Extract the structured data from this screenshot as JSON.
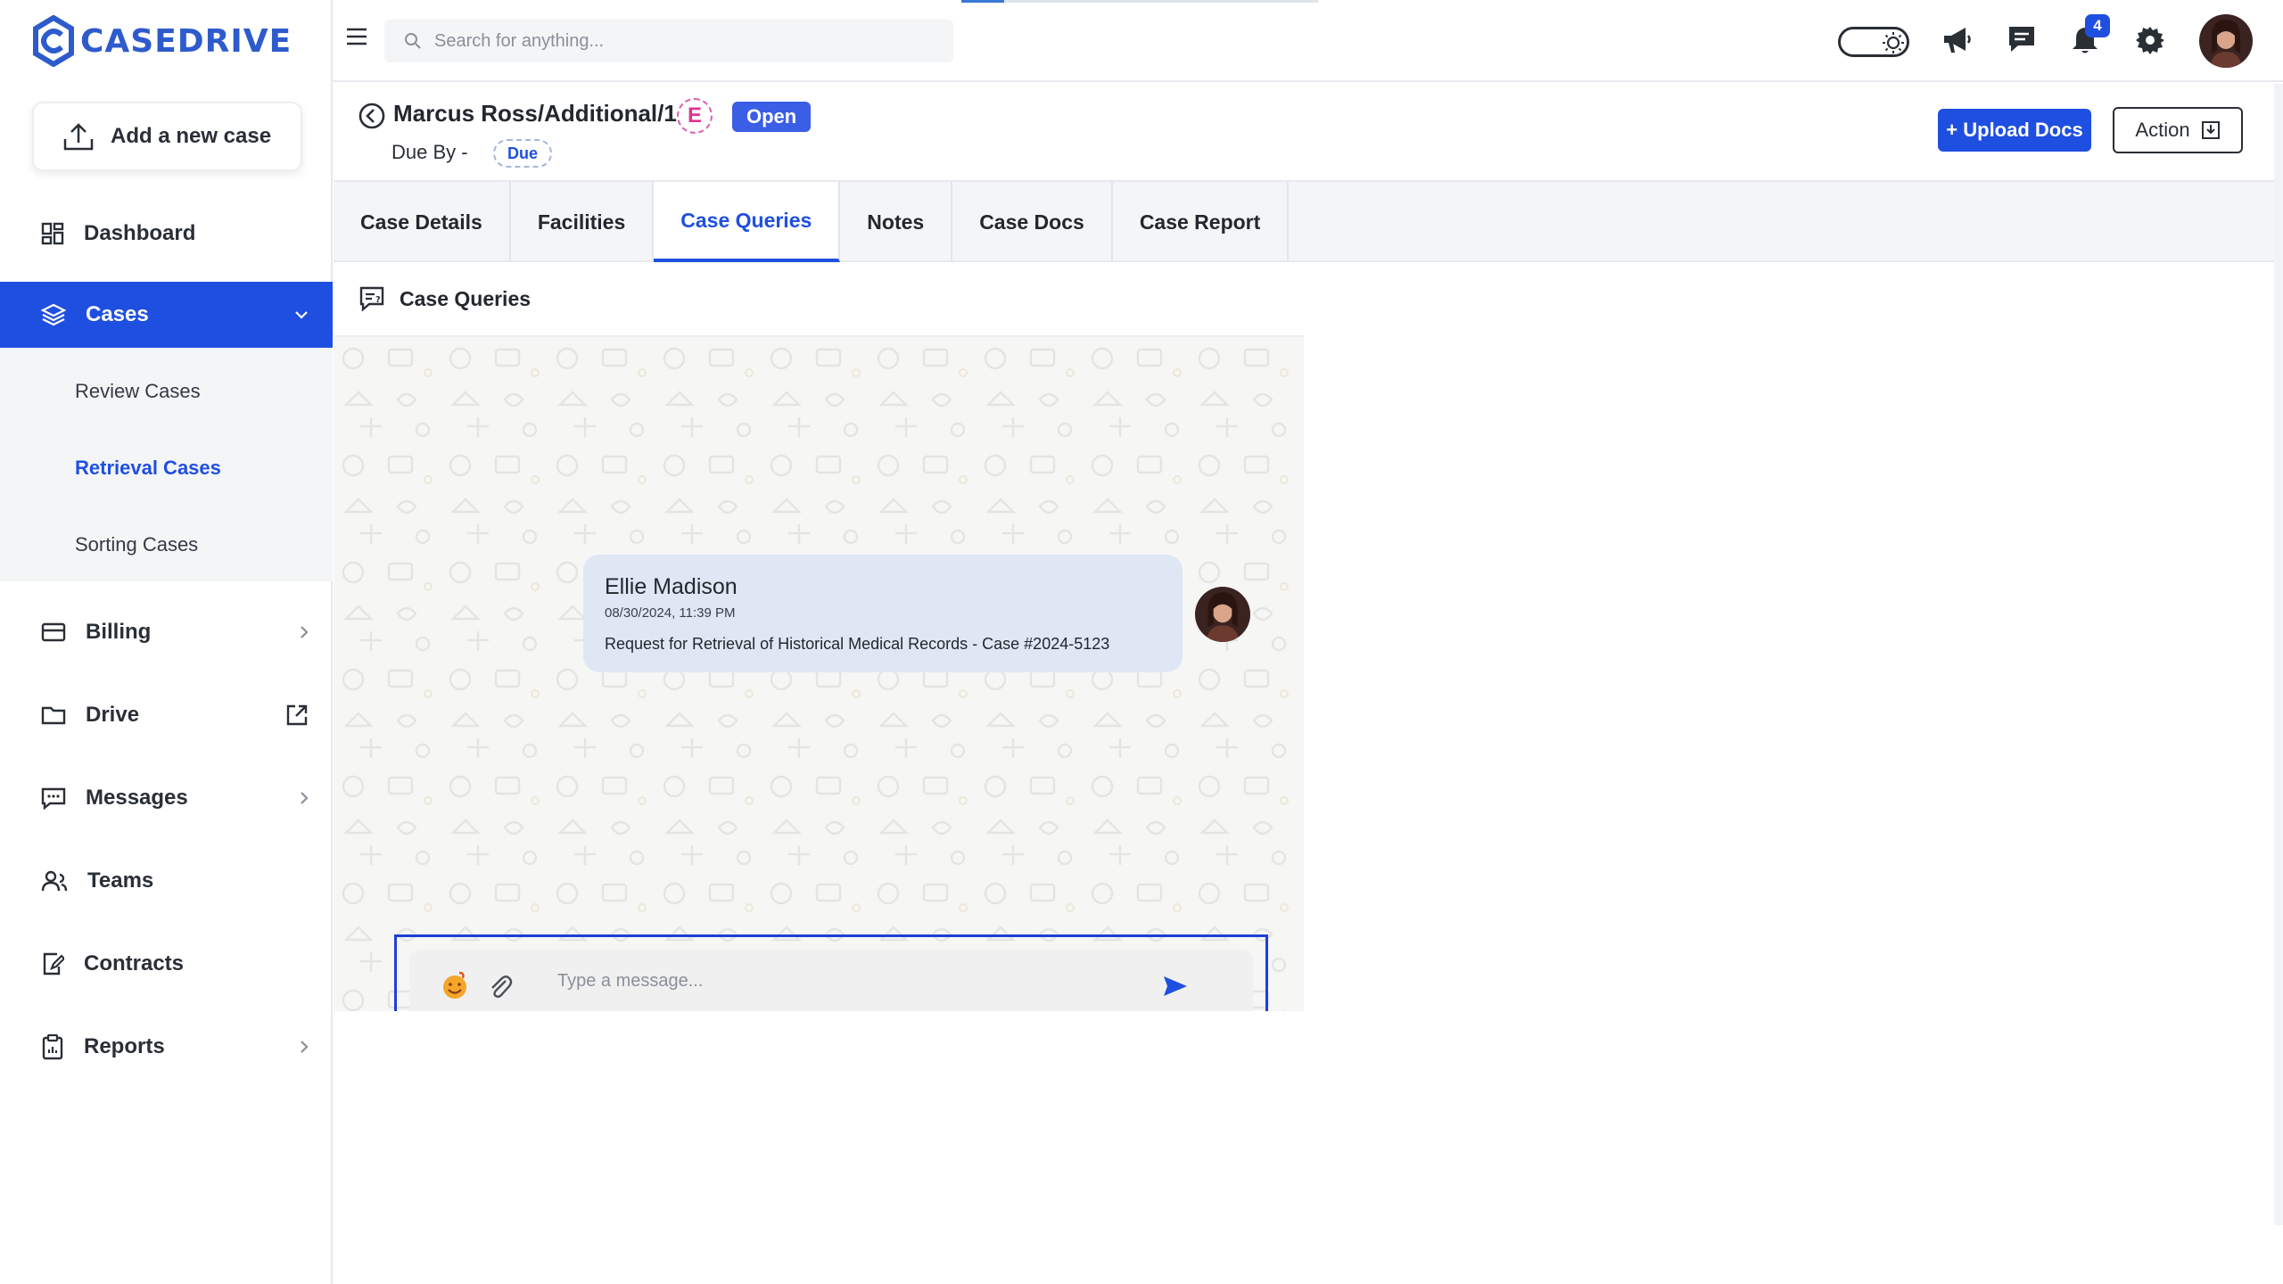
{
  "brand": {
    "name": "CASEDRIVE",
    "color": "#2e5bcc"
  },
  "sidebar": {
    "add_case_label": "Add a new case",
    "items": [
      {
        "label": "Dashboard",
        "icon": "dashboard-icon"
      },
      {
        "label": "Cases",
        "icon": "layers-icon",
        "active": true
      },
      {
        "label": "Billing",
        "icon": "card-icon"
      },
      {
        "label": "Drive",
        "icon": "folder-icon"
      },
      {
        "label": "Messages",
        "icon": "chat-icon"
      },
      {
        "label": "Teams",
        "icon": "users-icon"
      },
      {
        "label": "Contracts",
        "icon": "contract-icon"
      },
      {
        "label": "Reports",
        "icon": "clipboard-icon"
      }
    ],
    "sub_items": [
      {
        "label": "Review Cases"
      },
      {
        "label": "Retrieval Cases",
        "active": true
      },
      {
        "label": "Sorting Cases"
      }
    ]
  },
  "topbar": {
    "search_placeholder": "Search for anything...",
    "notification_count": "4",
    "page_load_progress": 0.12
  },
  "case": {
    "title": "Marcus Ross/Additional/1",
    "badge_letter": "E",
    "status": "Open",
    "due_label": "Due By -",
    "due_pill": "Due",
    "upload_label": "+ Upload Docs",
    "action_label": "Action"
  },
  "tabs": [
    {
      "label": "Case Details"
    },
    {
      "label": "Facilities"
    },
    {
      "label": "Case Queries",
      "active": true
    },
    {
      "label": "Notes"
    },
    {
      "label": "Case Docs"
    },
    {
      "label": "Case Report"
    }
  ],
  "queries": {
    "heading": "Case Queries",
    "messages": [
      {
        "sender": "Ellie Madison",
        "timestamp": "08/30/2024, 11:39 PM",
        "text": "Request for Retrieval of Historical Medical Records - Case #2024-5123"
      }
    ],
    "composer_placeholder": "Type a message..."
  },
  "colors": {
    "accent": "#1f4fe0",
    "status_open": "#3b5ee6"
  }
}
